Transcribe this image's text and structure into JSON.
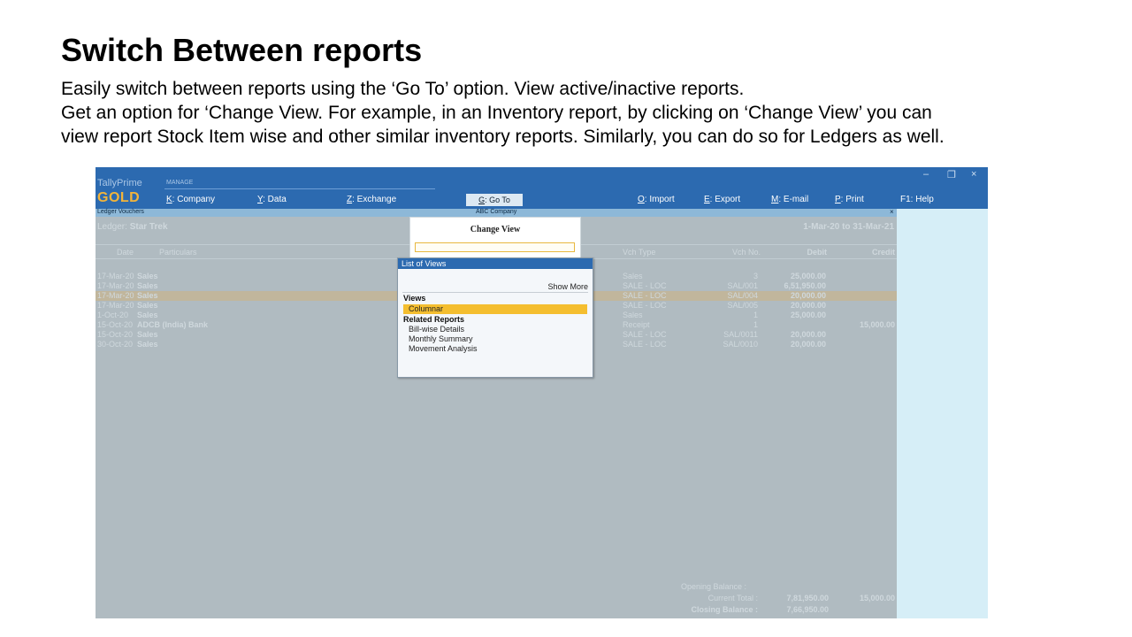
{
  "slide": {
    "title": "Switch Between reports",
    "lines": [
      "Easily switch between reports using the ‘Go To’ option. View active/inactive reports.",
      "Get an option for ‘Change View. For example, in an Inventory report, by clicking on ‘Change View’ you can",
      "view report Stock Item wise and other similar inventory reports. Similarly, you can do so for Ledgers as well."
    ]
  },
  "app": {
    "name": "TallyPrime",
    "edition": "GOLD",
    "manage_label": "MANAGE",
    "menu": [
      {
        "key": "K",
        "label": ": Company"
      },
      {
        "key": "Y",
        "label": ": Data"
      },
      {
        "key": "Z",
        "label": ": Exchange"
      },
      {
        "key": "O",
        "label": ": Import"
      },
      {
        "key": "E",
        "label": ": Export"
      },
      {
        "key": "M",
        "label": ": E-mail"
      },
      {
        "key": "P",
        "label": ": Print"
      },
      {
        "key": "F1",
        "label": ": Help"
      }
    ],
    "goto": {
      "key": "G",
      "label": ": Go To"
    },
    "window_controls": {
      "minimize": "–",
      "restore": "❐",
      "close": "×"
    }
  },
  "report": {
    "title": "Ledger Vouchers",
    "company": "ABC Company",
    "close": "×",
    "ledger_label": "Ledger:",
    "ledger_name": "Star Trek",
    "period": "1-Mar-20 to 31-Mar-21",
    "columns": {
      "date": "Date",
      "particulars": "Particulars",
      "vch_type": "Vch Type",
      "vch_no": "Vch No.",
      "debit": "Debit",
      "credit": "Credit"
    },
    "rows": [
      {
        "date": "17-Mar-20",
        "particulars": "Sales",
        "vch_type": "Sales",
        "vch_no": "3",
        "debit": "25,000.00",
        "credit": ""
      },
      {
        "date": "17-Mar-20",
        "particulars": "Sales",
        "vch_type": "SALE - LOC",
        "vch_no": "SAL/001",
        "debit": "6,51,950.00",
        "credit": ""
      },
      {
        "date": "17-Mar-20",
        "particulars": "Sales",
        "vch_type": "SALE - LOC",
        "vch_no": "SAL/004",
        "debit": "20,000.00",
        "credit": ""
      },
      {
        "date": "17-Mar-20",
        "particulars": "Sales",
        "vch_type": "SALE - LOC",
        "vch_no": "SAL/005",
        "debit": "20,000.00",
        "credit": ""
      },
      {
        "date": "1-Oct-20",
        "particulars": "Sales",
        "vch_type": "Sales",
        "vch_no": "1",
        "debit": "25,000.00",
        "credit": ""
      },
      {
        "date": "15-Oct-20",
        "particulars": "ADCB (India) Bank",
        "vch_type": "Receipt",
        "vch_no": "1",
        "debit": "",
        "credit": "15,000.00"
      },
      {
        "date": "15-Oct-20",
        "particulars": "Sales",
        "vch_type": "SALE - LOC",
        "vch_no": "SAL/0011",
        "debit": "20,000.00",
        "credit": ""
      },
      {
        "date": "30-Oct-20",
        "particulars": "Sales",
        "vch_type": "SALE - LOC",
        "vch_no": "SAL/0010",
        "debit": "20,000.00",
        "credit": ""
      }
    ],
    "highlighted_row": 2,
    "footer": {
      "opening_label": "Opening Balance :",
      "current_label": "Current Total :",
      "current_debit": "7,81,950.00",
      "current_credit": "15,000.00",
      "closing_label": "Closing Balance :",
      "closing_debit": "7,66,950.00"
    }
  },
  "change_view": {
    "title": "Change View",
    "input_value": ""
  },
  "list_of_views": {
    "header": "List of Views",
    "show_more": "Show More",
    "group_views": "Views",
    "views": [
      "Columnar"
    ],
    "group_related": "Related Reports",
    "related": [
      "Bill-wise Details",
      "Monthly Summary",
      "Movement Analysis"
    ]
  }
}
